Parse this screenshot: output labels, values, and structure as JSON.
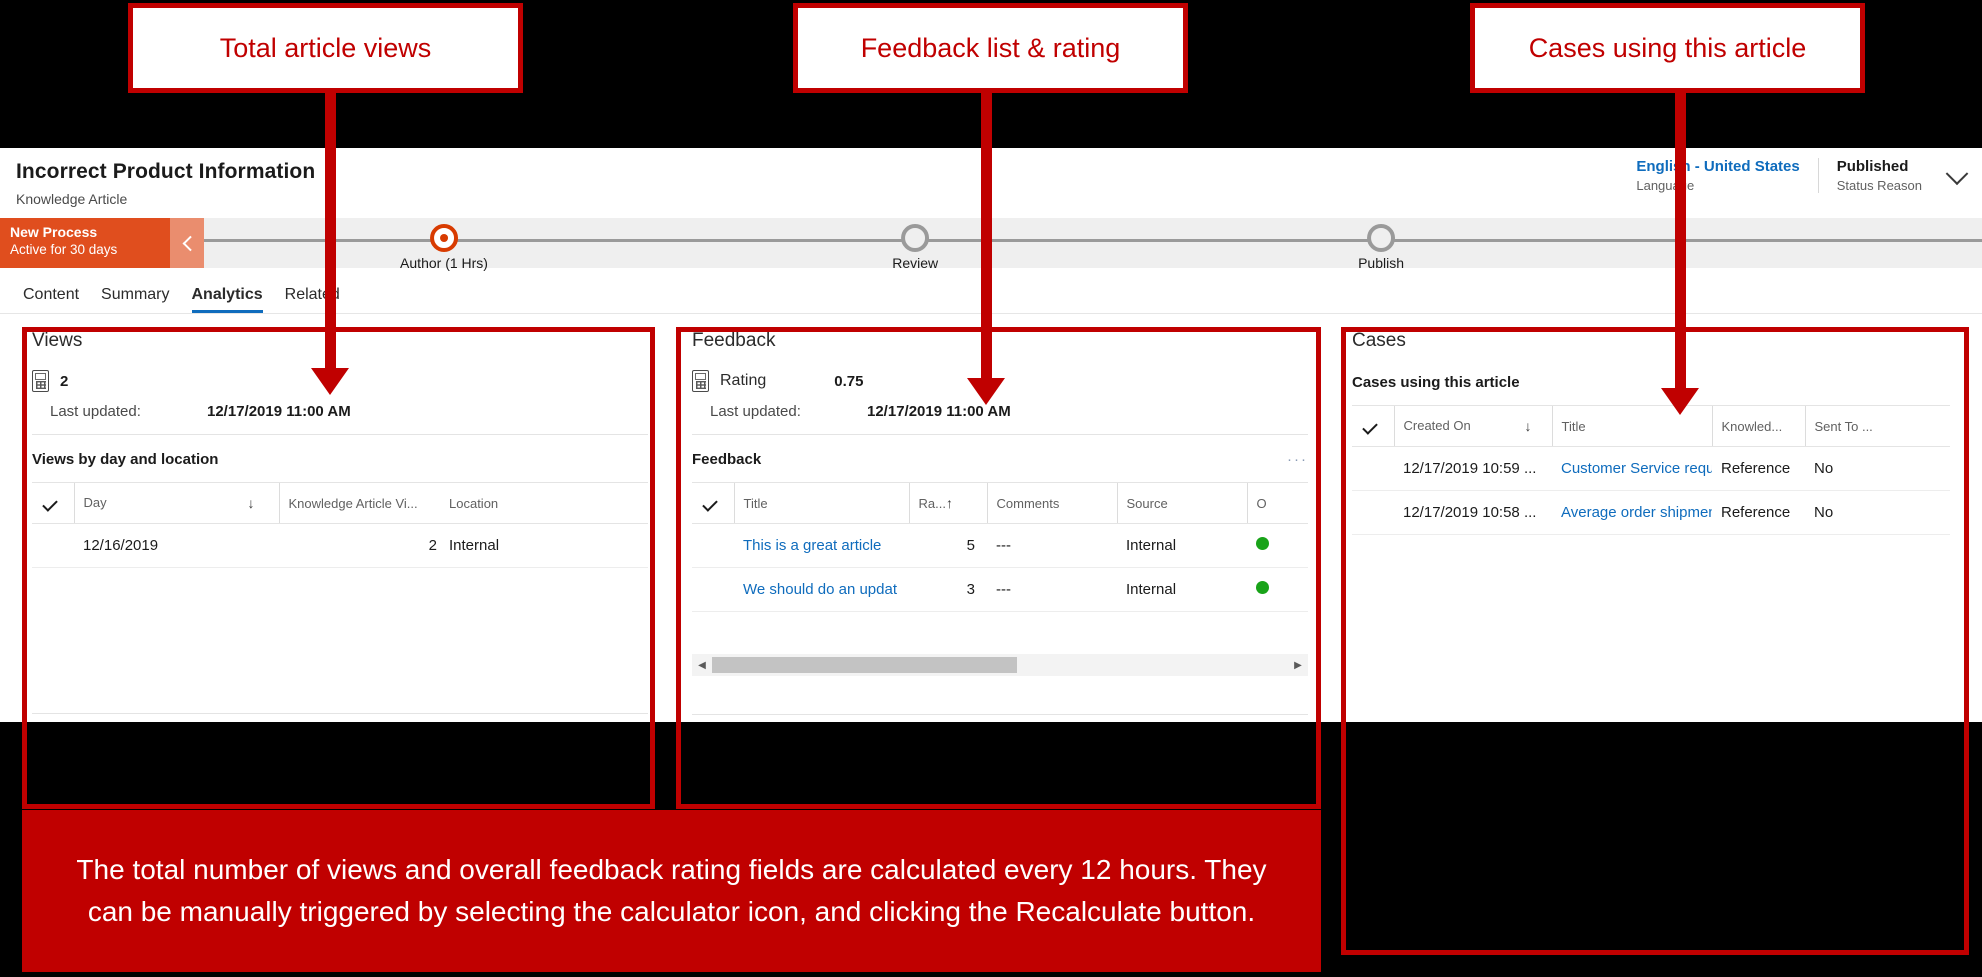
{
  "callouts": [
    {
      "label": "Total article views"
    },
    {
      "label": "Feedback list & rating"
    },
    {
      "label": "Cases using this article"
    }
  ],
  "caption": "The total number of views and overall feedback rating fields are calculated every 12 hours.  They can be manually triggered by selecting the calculator icon, and clicking the Recalculate button.",
  "header": {
    "title": "Incorrect Product Information",
    "subtitle": "Knowledge Article",
    "language_value": "English - United States",
    "language_label": "Language",
    "status_value": "Published",
    "status_label": "Status Reason"
  },
  "bpf": {
    "name": "New Process",
    "duration": "Active for 30 days",
    "stages": [
      {
        "label": "Author  (1 Hrs)",
        "state": "active"
      },
      {
        "label": "Review",
        "state": "pending"
      },
      {
        "label": "Publish",
        "state": "pending"
      }
    ]
  },
  "tabs": [
    {
      "label": "Content",
      "active": false
    },
    {
      "label": "Summary",
      "active": false
    },
    {
      "label": "Analytics",
      "active": true
    },
    {
      "label": "Related",
      "active": false
    }
  ],
  "views_panel": {
    "title": "Views",
    "metric_value": "2",
    "last_updated_label": "Last updated:",
    "last_updated_value": "12/17/2019 11:00 AM",
    "grid_title": "Views by day and location",
    "columns": [
      "Day",
      "Knowledge Article Vi...",
      "Location"
    ],
    "sort_arrow": "↓",
    "rows": [
      {
        "day": "12/16/2019",
        "views": "2",
        "location": "Internal"
      }
    ]
  },
  "feedback_panel": {
    "title": "Feedback",
    "metric_label": "Rating",
    "metric_value": "0.75",
    "last_updated_label": "Last updated:",
    "last_updated_value": "12/17/2019 11:00 AM",
    "grid_title": "Feedback",
    "overflow": "···",
    "columns": [
      "Title",
      "Ra...",
      "Comments",
      "Source",
      "O"
    ],
    "sort_arrow": "↑",
    "rows": [
      {
        "title": "This is a great article",
        "rating": "5",
        "comments": "---",
        "source": "Internal"
      },
      {
        "title": "We should do an updat",
        "rating": "3",
        "comments": "---",
        "source": "Internal"
      }
    ]
  },
  "cases_panel": {
    "title": "Cases",
    "grid_title": "Cases using this article",
    "columns": [
      "Created On",
      "Title",
      "Knowled...",
      "Sent To ..."
    ],
    "sort_arrow": "↓",
    "rows": [
      {
        "created": "12/17/2019 10:59 ...",
        "title": "Customer Service reque",
        "knowledge": "Reference",
        "sent": "No"
      },
      {
        "created": "12/17/2019 10:58 ...",
        "title": "Average order shipmen",
        "knowledge": "Reference",
        "sent": "No"
      }
    ]
  }
}
